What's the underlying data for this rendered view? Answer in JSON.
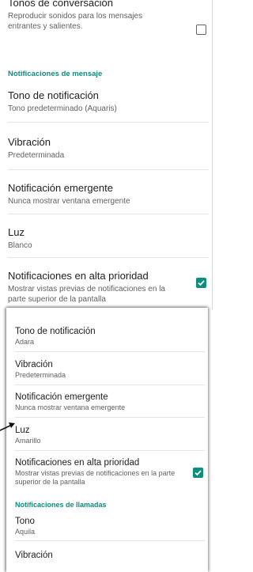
{
  "top_panel": {
    "conversation_tones": {
      "title": "Tonos de conversación",
      "subtitle": "Reproducir sonidos para los mensajes entrantes y salientes.",
      "checked": false
    },
    "section_title": "Notificaciones de mensaje",
    "tone": {
      "title": "Tono de notificación",
      "subtitle": "Tono predeterminado (Aquaris)"
    },
    "vibration": {
      "title": "Vibración",
      "subtitle": "Predeterminada"
    },
    "popup": {
      "title": "Notificación emergente",
      "subtitle": "Nunca mostrar ventana emergente"
    },
    "light": {
      "title": "Luz",
      "subtitle": "Blanco"
    },
    "high_priority": {
      "title": "Notificaciones en alta prioridad",
      "subtitle": "Mostrar vistas previas de notificaciones en la parte superior de la pantalla",
      "checked": true
    }
  },
  "bottom_panel": {
    "tone": {
      "title": "Tono de notificación",
      "subtitle": "Adara"
    },
    "vibration": {
      "title": "Vibración",
      "subtitle": "Predeterminada"
    },
    "popup": {
      "title": "Notificación emergente",
      "subtitle": "Nunca mostrar ventana emergente"
    },
    "light": {
      "title": "Luz",
      "subtitle": "Amarillo"
    },
    "high_priority": {
      "title": "Notificaciones en alta prioridad",
      "subtitle": "Mostrar vistas previas de notificaciones en la parte superior de la pantalla",
      "checked": true
    },
    "calls_section_title": "Notificaciones de llamadas",
    "ringtone": {
      "title": "Tono",
      "subtitle": "Aquila"
    },
    "call_vibration": {
      "title": "Vibración"
    }
  },
  "colors": {
    "accent": "#0e8f7e",
    "section": "#0b8f7f"
  }
}
